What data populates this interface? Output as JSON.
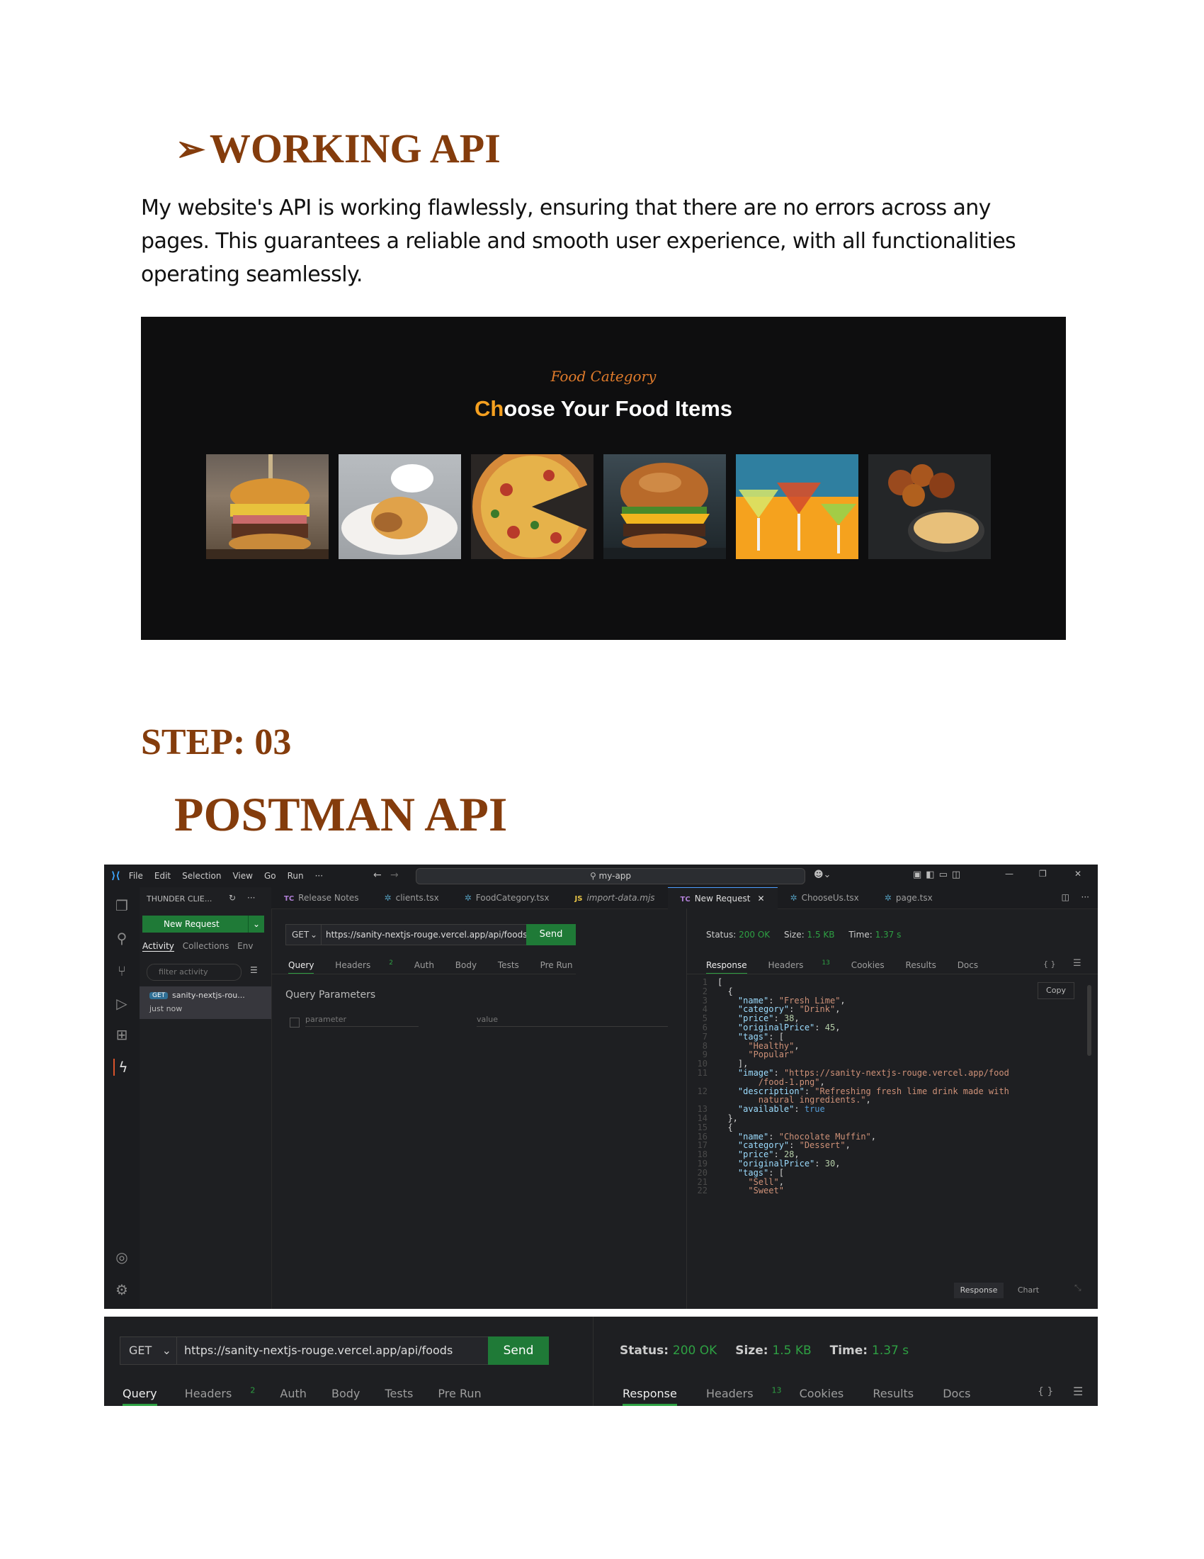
{
  "section1": {
    "heading_arrow": "➢",
    "heading": "WORKING API",
    "intro": "My website's API is working flawlessly, ensuring that there are no errors across any pages. This guarantees a reliable and smooth user experience, with all functionalities operating seamlessly."
  },
  "food_screenshot": {
    "subtitle": "Food Category",
    "title_highlight": "Ch",
    "title_rest": "oose Your Food Items",
    "images": [
      "burger",
      "plated dish",
      "pizza",
      "cheeseburger",
      "cocktails",
      "fried chicken"
    ]
  },
  "section2": {
    "step": "STEP: 03",
    "heading": "POSTMAN API"
  },
  "vscode": {
    "menu": [
      "File",
      "Edit",
      "Selection",
      "View",
      "Go",
      "Run",
      "···"
    ],
    "search": "my-app",
    "sidebar": {
      "title": "THUNDER CLIE...",
      "new_request": "New Request",
      "tabs": [
        "Activity",
        "Collections",
        "Env"
      ],
      "filter_placeholder": "filter activity",
      "item_method": "GET",
      "item_name": "sanity-nextjs-rou...",
      "item_time": "just now"
    },
    "tabs": [
      {
        "badge": "TC",
        "label": "Release Notes"
      },
      {
        "badge": "gear",
        "label": "clients.tsx"
      },
      {
        "badge": "gear",
        "label": "FoodCategory.tsx"
      },
      {
        "badge": "JS",
        "label": "import-data.mjs"
      },
      {
        "badge": "TC",
        "label": "New Request",
        "close": "✕"
      },
      {
        "badge": "gear",
        "label": "ChooseUs.tsx"
      },
      {
        "badge": "gear",
        "label": "page.tsx"
      }
    ],
    "request": {
      "method": "GET",
      "url": "https://sanity-nextjs-rouge.vercel.app/api/foods",
      "send": "Send",
      "subtabs": [
        "Query",
        "Headers",
        "Auth",
        "Body",
        "Tests",
        "Pre Run"
      ],
      "headers_count": "2",
      "query_params_title": "Query Parameters",
      "param_placeholder": "parameter",
      "value_placeholder": "value"
    },
    "response": {
      "status_label": "Status:",
      "status": "200 OK",
      "size_label": "Size:",
      "size": "1.5 KB",
      "time_label": "Time:",
      "time": "1.37 s",
      "subtabs": [
        "Response",
        "Headers",
        "Cookies",
        "Results",
        "Docs"
      ],
      "headers_count": "13",
      "copy": "Copy",
      "footer_response": "Response",
      "footer_chart": "Chart",
      "braces": "{ }"
    }
  },
  "strip": {
    "method": "GET",
    "url": "https://sanity-nextjs-rouge.vercel.app/api/foods",
    "send": "Send",
    "subtabs": [
      "Query",
      "Headers",
      "Auth",
      "Body",
      "Tests",
      "Pre Run"
    ],
    "headers_count": "2",
    "status_label": "Status:",
    "status": "200 OK",
    "size_label": "Size:",
    "size": "1.5 KB",
    "time_label": "Time:",
    "time": "1.37 s",
    "resp_tabs": [
      "Response",
      "Headers",
      "Cookies",
      "Results",
      "Docs"
    ],
    "resp_headers_count": "13",
    "braces": "{ }"
  },
  "colors": {
    "heading": "#843c0c",
    "accent_orange": "#f5a020",
    "send_green": "#1f7a37",
    "status_green": "#2ea043"
  }
}
